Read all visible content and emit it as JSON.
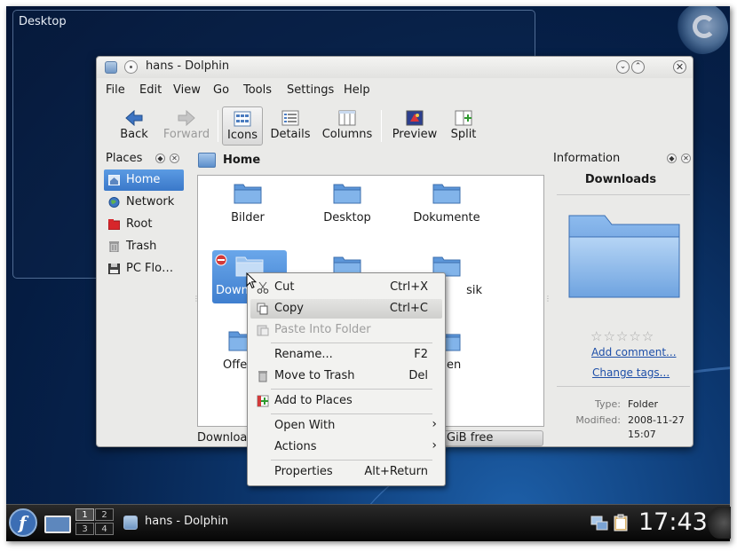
{
  "desktop": {
    "label": "Desktop"
  },
  "window": {
    "title": "hans - Dolphin",
    "buttons": {
      "sticky": "•",
      "minimize": "⌄",
      "maximize": "⌃",
      "close": "✕"
    }
  },
  "menubar": {
    "items": [
      "File",
      "Edit",
      "View",
      "Go",
      "Tools",
      "Settings",
      "Help"
    ]
  },
  "toolbar": {
    "back": "Back",
    "forward": "Forward",
    "icons": "Icons",
    "details": "Details",
    "columns": "Columns",
    "preview": "Preview",
    "split": "Split"
  },
  "places": {
    "header": "Places",
    "items": [
      {
        "label": "Home",
        "icon": "home-icon",
        "selected": true
      },
      {
        "label": "Network",
        "icon": "network-globe-icon"
      },
      {
        "label": "Root",
        "icon": "root-folder-icon"
      },
      {
        "label": "Trash",
        "icon": "trash-icon"
      },
      {
        "label": "PC Flo…",
        "icon": "floppy-drive-icon"
      }
    ]
  },
  "location": {
    "breadcrumb": "Home"
  },
  "files": [
    {
      "name": "Bilder"
    },
    {
      "name": "Desktop"
    },
    {
      "name": "Dokumente"
    },
    {
      "name": "Down",
      "selected": true
    },
    {
      "name": ""
    },
    {
      "name": "sik"
    },
    {
      "name": "Öffe"
    },
    {
      "name": ""
    },
    {
      "name": "agen"
    }
  ],
  "statusbar": {
    "label": "Download",
    "free_space": "GiB free"
  },
  "information": {
    "header": "Information",
    "title": "Downloads",
    "rating_stars": "☆☆☆☆☆",
    "add_comment": "Add comment...",
    "change_tags": "Change tags...",
    "type_label": "Type:",
    "type_value": "Folder",
    "modified_label": "Modified:",
    "modified_date": "2008-11-27",
    "modified_time": "15:07"
  },
  "context_menu": {
    "items": [
      {
        "label": "Cut",
        "shortcut": "Ctrl+X"
      },
      {
        "label": "Copy",
        "shortcut": "Ctrl+C"
      },
      {
        "label": "Paste Into Folder",
        "shortcut": ""
      },
      {
        "label": "Rename...",
        "shortcut": "F2"
      },
      {
        "label": "Move to Trash",
        "shortcut": "Del"
      },
      {
        "label": "Add to Places",
        "shortcut": ""
      },
      {
        "label": "Open With",
        "shortcut": ""
      },
      {
        "label": "Actions",
        "shortcut": ""
      },
      {
        "label": "Properties",
        "shortcut": "Alt+Return"
      }
    ],
    "submenu_arrow": "›"
  },
  "taskbar": {
    "launcher_glyph": "f",
    "pager": [
      "1",
      "2",
      "3",
      "4"
    ],
    "task_label": "hans - Dolphin",
    "clock": "17:43"
  },
  "colors": {
    "selection": "#3f7fcf",
    "desktop_dark": "#06214a",
    "folder_blue": "#6fa5e0"
  }
}
